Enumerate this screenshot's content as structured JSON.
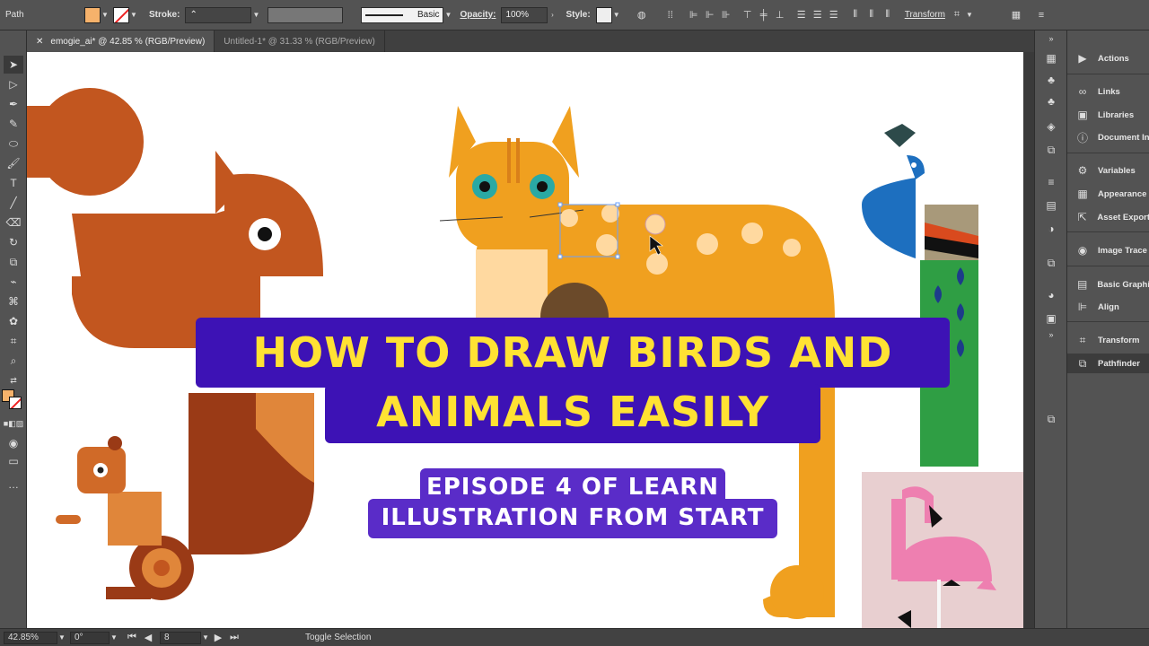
{
  "control_bar": {
    "selection_type": "Path",
    "stroke_label": "Stroke:",
    "brush_label": "Basic",
    "opacity_label": "Opacity:",
    "opacity_value": "100%",
    "style_label": "Style:",
    "transform_label": "Transform",
    "fill_color": "#f6b26b"
  },
  "tabs": [
    {
      "label": "emogie_ai* @ 42.85 % (RGB/Preview)",
      "active": true
    },
    {
      "label": "Untitled-1* @ 31.33 % (RGB/Preview)",
      "active": false
    }
  ],
  "panels": [
    {
      "label": "Actions",
      "icon": "play-icon"
    },
    {
      "label": "Links",
      "icon": "link-icon"
    },
    {
      "label": "Libraries",
      "icon": "libraries-icon"
    },
    {
      "label": "Document In",
      "icon": "document-info-icon"
    },
    {
      "label": "Variables",
      "icon": "variables-icon"
    },
    {
      "label": "Appearance",
      "icon": "appearance-icon"
    },
    {
      "label": "Asset Export",
      "icon": "asset-export-icon"
    },
    {
      "label": "Image Trace",
      "icon": "image-trace-icon"
    },
    {
      "label": "Basic Graphi",
      "icon": "graphic-styles-icon"
    },
    {
      "label": "Align",
      "icon": "align-icon"
    },
    {
      "label": "Transform",
      "icon": "transform-icon"
    },
    {
      "label": "Pathfinder",
      "icon": "pathfinder-icon"
    }
  ],
  "status_bar": {
    "zoom": "42.85%",
    "rotation": "0°",
    "artboard": "8",
    "mode": "Toggle Selection"
  },
  "overlay": {
    "headline_line1": "HOW TO DRAW BIRDS AND",
    "headline_line2": "ANIMALS EASILY",
    "subtitle_line1": "EPISODE 4 OF LEARN",
    "subtitle_line2": "ILLUSTRATION FROM START"
  },
  "colors": {
    "squirrel": "#c2561f",
    "cat": "#f0a01f",
    "peacock_blue": "#1d6fbf",
    "peacock_green": "#2f9e44",
    "flamingo": "#ee7fb0",
    "headline_bg": "#3d12b5",
    "headline_text": "#ffe233",
    "subtitle_bg": "#5a2cc8"
  }
}
